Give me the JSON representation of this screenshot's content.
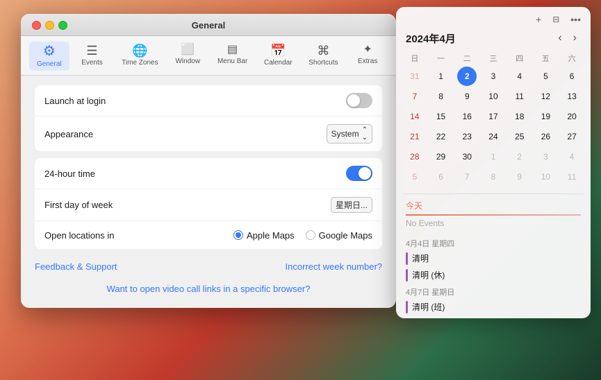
{
  "window": {
    "title": "General",
    "trafficLights": [
      "close",
      "minimize",
      "maximize"
    ]
  },
  "toolbar": {
    "items": [
      {
        "id": "general",
        "label": "General",
        "icon": "⚙",
        "active": true
      },
      {
        "id": "events",
        "label": "Events",
        "icon": "≡",
        "active": false
      },
      {
        "id": "timezones",
        "label": "Time Zones",
        "icon": "🌐",
        "active": false
      },
      {
        "id": "window",
        "label": "Window",
        "icon": "▭",
        "active": false
      },
      {
        "id": "menubar",
        "label": "Menu Bar",
        "icon": "⊟",
        "active": false
      },
      {
        "id": "calendar",
        "label": "Calendar",
        "icon": "📅",
        "active": false
      },
      {
        "id": "shortcuts",
        "label": "Shortcuts",
        "icon": "⌘",
        "active": false
      },
      {
        "id": "extras",
        "label": "Extras",
        "icon": "✦",
        "active": false
      }
    ]
  },
  "settings": {
    "group1": [
      {
        "label": "Launch at login",
        "type": "toggle",
        "value": false
      },
      {
        "label": "Appearance",
        "type": "select",
        "value": "System"
      }
    ],
    "group2": [
      {
        "label": "24-hour time",
        "type": "toggle",
        "value": true
      },
      {
        "label": "First day of week",
        "type": "select",
        "value": "星期日..."
      },
      {
        "label": "Open locations in",
        "type": "radio",
        "options": [
          "Apple Maps",
          "Google Maps"
        ],
        "selected": "Apple Maps"
      }
    ],
    "links": {
      "left": "Feedback & Support",
      "right": "Incorrect week number?"
    },
    "bottomLink": "Want to open video call links in a specific browser?"
  },
  "calendar": {
    "topIcons": [
      "+",
      "⊞",
      "•••"
    ],
    "monthTitle": "2024年4月",
    "dayHeaders": [
      "日",
      "一",
      "二",
      "三",
      "四",
      "五",
      "六"
    ],
    "weeks": [
      [
        {
          "day": "31",
          "otherMonth": true,
          "sunday": true
        },
        {
          "day": "1",
          "otherMonth": false
        },
        {
          "day": "2",
          "otherMonth": false,
          "today": true
        },
        {
          "day": "3",
          "otherMonth": false
        },
        {
          "day": "4",
          "otherMonth": false
        },
        {
          "day": "5",
          "otherMonth": false
        },
        {
          "day": "6",
          "otherMonth": false
        }
      ],
      [
        {
          "day": "7",
          "otherMonth": false,
          "sunday": true
        },
        {
          "day": "8",
          "otherMonth": false
        },
        {
          "day": "9",
          "otherMonth": false
        },
        {
          "day": "10",
          "otherMonth": false
        },
        {
          "day": "11",
          "otherMonth": false
        },
        {
          "day": "12",
          "otherMonth": false
        },
        {
          "day": "13",
          "otherMonth": false
        }
      ],
      [
        {
          "day": "14",
          "otherMonth": false,
          "sunday": true
        },
        {
          "day": "15",
          "otherMonth": false
        },
        {
          "day": "16",
          "otherMonth": false
        },
        {
          "day": "17",
          "otherMonth": false
        },
        {
          "day": "18",
          "otherMonth": false
        },
        {
          "day": "19",
          "otherMonth": false
        },
        {
          "day": "20",
          "otherMonth": false
        }
      ],
      [
        {
          "day": "21",
          "otherMonth": false,
          "sunday": true
        },
        {
          "day": "22",
          "otherMonth": false
        },
        {
          "day": "23",
          "otherMonth": false
        },
        {
          "day": "24",
          "otherMonth": false
        },
        {
          "day": "25",
          "otherMonth": false
        },
        {
          "day": "26",
          "otherMonth": false
        },
        {
          "day": "27",
          "otherMonth": false
        }
      ],
      [
        {
          "day": "28",
          "otherMonth": false,
          "sunday": true
        },
        {
          "day": "29",
          "otherMonth": false
        },
        {
          "day": "30",
          "otherMonth": false
        },
        {
          "day": "1",
          "otherMonth": true
        },
        {
          "day": "2",
          "otherMonth": true
        },
        {
          "day": "3",
          "otherMonth": true
        },
        {
          "day": "4",
          "otherMonth": true
        }
      ],
      [
        {
          "day": "5",
          "otherMonth": true,
          "sunday": true
        },
        {
          "day": "6",
          "otherMonth": true
        },
        {
          "day": "7",
          "otherMonth": true
        },
        {
          "day": "8",
          "otherMonth": true
        },
        {
          "day": "9",
          "otherMonth": true
        },
        {
          "day": "10",
          "otherMonth": true
        },
        {
          "day": "11",
          "otherMonth": true
        }
      ]
    ],
    "todayLabel": "今天",
    "noEvents": "No Events",
    "eventSections": [
      {
        "header": "4月4日 星期四",
        "events": [
          "清明",
          "清明 (休)"
        ]
      },
      {
        "header": "4月7日 星期日",
        "events": [
          "清明 (班)"
        ]
      }
    ]
  }
}
